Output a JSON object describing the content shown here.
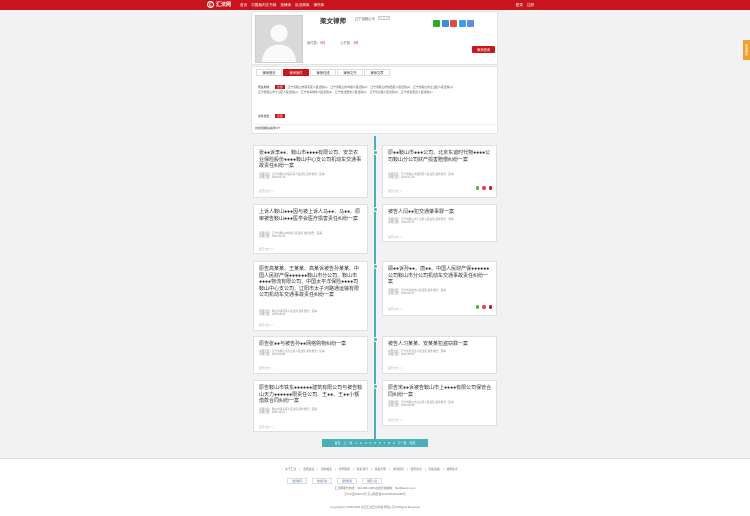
{
  "topbar": {
    "logo_mark": "汇",
    "logo_text": "汇法网",
    "nav": [
      "首页",
      "中国裁判文书网",
      "找律师",
      "民法典库",
      "律所库"
    ],
    "right": [
      "登录",
      "注册"
    ]
  },
  "profile": {
    "name": "梁文律师",
    "firm": "辽宁省鞍山市",
    "stats": [
      {
        "label": "案件数：",
        "value": "9件"
      },
      {
        "label": "公开数：",
        "value": "9件"
      }
    ],
    "consult_label": "律师咨询",
    "share_colors": [
      "#2aae2a",
      "#3a8fd9",
      "#e04848",
      "#3aa0e8",
      "#5b8fd9"
    ]
  },
  "sidetab": "咨询服务",
  "tabs": [
    "律师首页",
    "律师案件",
    "律师在线",
    "律师文书",
    "律师文章"
  ],
  "active_tab": 1,
  "filters": {
    "region_label": "所在地域：",
    "all_label": "全部",
    "region_items": [
      "辽宁省鞍山市铁东区人民法院(1)",
      "辽宁省鞍山市中级人民法院(2)",
      "辽宁省鞍山市铁西区人民法院(1)",
      "辽宁省鞍山市立山区人民法院(1)",
      "辽宁省鞍山市千山区人民法院(1)",
      "辽宁省海城市人民法院(1)",
      "辽宁省沈阳市人民法院(1)",
      "辽宁省高级人民法院(1)",
      "辽宁省台安县人民法院(1)"
    ],
    "type_label": "案件类型：",
    "type_all": "全部"
  },
  "found_text": "共找到相关案件9个",
  "cards_left": [
    {
      "title": "张●●诉李●●、鞍山市●●●●有限公司、安华农业保险股份●●●●鞍山中心支公司机动车交通事故责任纠纷一案",
      "meta1": "审理法院：辽宁省鞍山市铁东区人民法院",
      "meta2": "案件类型：民事",
      "meta3": "审理日期：2015-02-13",
      "more": "展开全文 >>"
    },
    {
      "title": "上诉人鞍山●●●因与被上诉人马●●、马●●、原审被告鞍山●●●医学会医疗损害责任纠纷一案",
      "meta1": "审理法院：辽宁省鞍山市中级人民法院",
      "meta2": "案件类型：民事",
      "meta3": "审理日期：2016-03-11",
      "more": "展开全文 >>"
    },
    {
      "title": "原告高某某、王某某、高某诉被告孙某某、中国人民财产保●●●●●●鞍山市分公司、鞍山市●●●●物流有限公司、中国太平洋保险●●●●司鞍山中心支公司、辽阳市太子河路通运输有限公司机动车交通事故责任纠纷一案",
      "meta1": "审理法院：鞍山市铁西区人民法院",
      "meta2": "案件类型：民事",
      "meta3": "审理日期：2016-08-03",
      "more": "展开全文 >>"
    },
    {
      "title": "原告张●●与被告孙●●网络购物纠纷一案",
      "meta1": "审理法院：辽宁省鞍山市立山区人民法院",
      "meta2": "案件类型：民事",
      "meta3": "审理日期：2016-08-08",
      "more": "展开全文 >>"
    },
    {
      "title": "原告鞍山市铁东●●●●●●建筑有限公司与被告鞍山天力●●●●●●限责任公司、王●●、王●●小额借款合同纠纷一案",
      "meta1": "审理法院：鞍山市铁东区人民法院",
      "meta2": "案件类型：民事",
      "meta3": "审理日期：2016-12-07",
      "more": "展开全文 >>"
    }
  ],
  "cards_right": [
    {
      "title": "原●●鞍山市●●●公司、北京东谊时代物●●●●公司鞍山分公司财产损害赔偿纠纷一案",
      "meta1": "审理法院：辽宁省鞍山市铁西区人民法院",
      "meta2": "案件类型：民事",
      "meta3": "审理日期：2015-01-22",
      "more": "展开全文 >>"
    },
    {
      "title": "被告人闫●●犯交通肇事罪一案",
      "meta1": "审理法院：辽宁省鞍山市千山区人民法院",
      "meta2": "案件类型：刑事",
      "meta3": "审理日期：2016-05-11",
      "more": "展开全文 >>"
    },
    {
      "title": "顾●●诉孙●●、唐●●、中国人民财产保●●●●●●公司鞍山市分公司机动车交通事故责任纠纷一案",
      "meta1": "审理法院：辽宁省海城市人民法院",
      "meta2": "案件类型：民事",
      "meta3": "审理日期：2016-06-27",
      "more": "展开全文 >>"
    },
    {
      "title": "被告人习某某、安某某犯盗窃罪一案",
      "meta1": "审理法院：辽宁省台安县人民法院",
      "meta2": "案件类型：刑事",
      "meta3": "审理日期：2016-08-20",
      "more": "展开全文 >>"
    },
    {
      "title": "原告宋●●诉被告鞍山市上●●●●有限公司保管合同纠纷一案",
      "meta1": "审理法院：辽宁省鞍山市立山区人民法院",
      "meta2": "案件类型：民事",
      "meta3": "审理日期：2016-09-20",
      "more": "展开全文 >>"
    }
  ],
  "pager": [
    "首页",
    "上一页",
    "1",
    "2",
    "3",
    "4",
    "5",
    "6",
    "7",
    "8",
    "9",
    "下一页",
    "尾页"
  ],
  "footer": {
    "links": [
      "关于汇法",
      "法规速递",
      "招纳精英",
      "律师联盟",
      "联系我们",
      "版权声明",
      "法律顾问",
      "服务协议",
      "隐私政策",
      "诚聘英才"
    ],
    "badges": [
      "法律顾问",
      "在线咨询",
      "案例检索",
      "律所入驻"
    ],
    "line1": "汇法网服务热线：400-089-1088 在线咨询邮箱：hfw@lawxp.com",
    "line2": "京ICP证050234号 京公网安备11010502026468号",
    "copyright": "Copyright(C) 2006-2020 北京汇法正信科技有限公司 All Rights Reserved"
  }
}
